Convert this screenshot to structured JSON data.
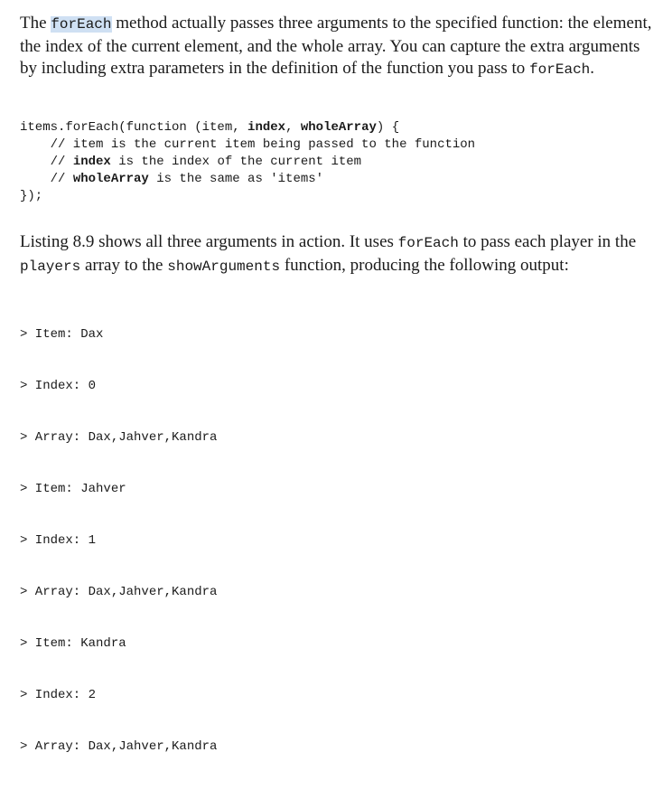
{
  "paragraph1": {
    "t1": "The ",
    "c1": "forEach",
    "t2": " method actually passes three arguments to the specified function: the element, the index of the current element, and the whole array. You can capture the extra arguments by including extra parameters in the definition of the function you pass to ",
    "c2": "forEach",
    "t3": "."
  },
  "code_listing": {
    "l1_a": "items.forEach(function (item, ",
    "l1_b": "index",
    "l1_c": ", ",
    "l1_d": "wholeArray",
    "l1_e": ") {",
    "l2": "    // item is the current item being passed to the function",
    "l3_a": "    // ",
    "l3_b": "index",
    "l3_c": " is the index of the current item",
    "l4_a": "    // ",
    "l4_b": "wholeArray",
    "l4_c": " is the same as 'items'",
    "l5": "});"
  },
  "paragraph2": {
    "t1": "Listing 8.9 shows all three arguments in action. It uses ",
    "c1": "forEach",
    "t2": " to pass each player in the ",
    "c2": "players",
    "t3": " array to the ",
    "c3": "showArguments",
    "t4": " function, producing the following output:"
  },
  "output_lines": [
    "> Item: Dax",
    "> Index: 0",
    "> Array: Dax,Jahver,Kandra",
    "> Item: Jahver",
    "> Index: 1",
    "> Array: Dax,Jahver,Kandra",
    "> Item: Kandra",
    "> Index: 2",
    "> Array: Dax,Jahver,Kandra"
  ]
}
